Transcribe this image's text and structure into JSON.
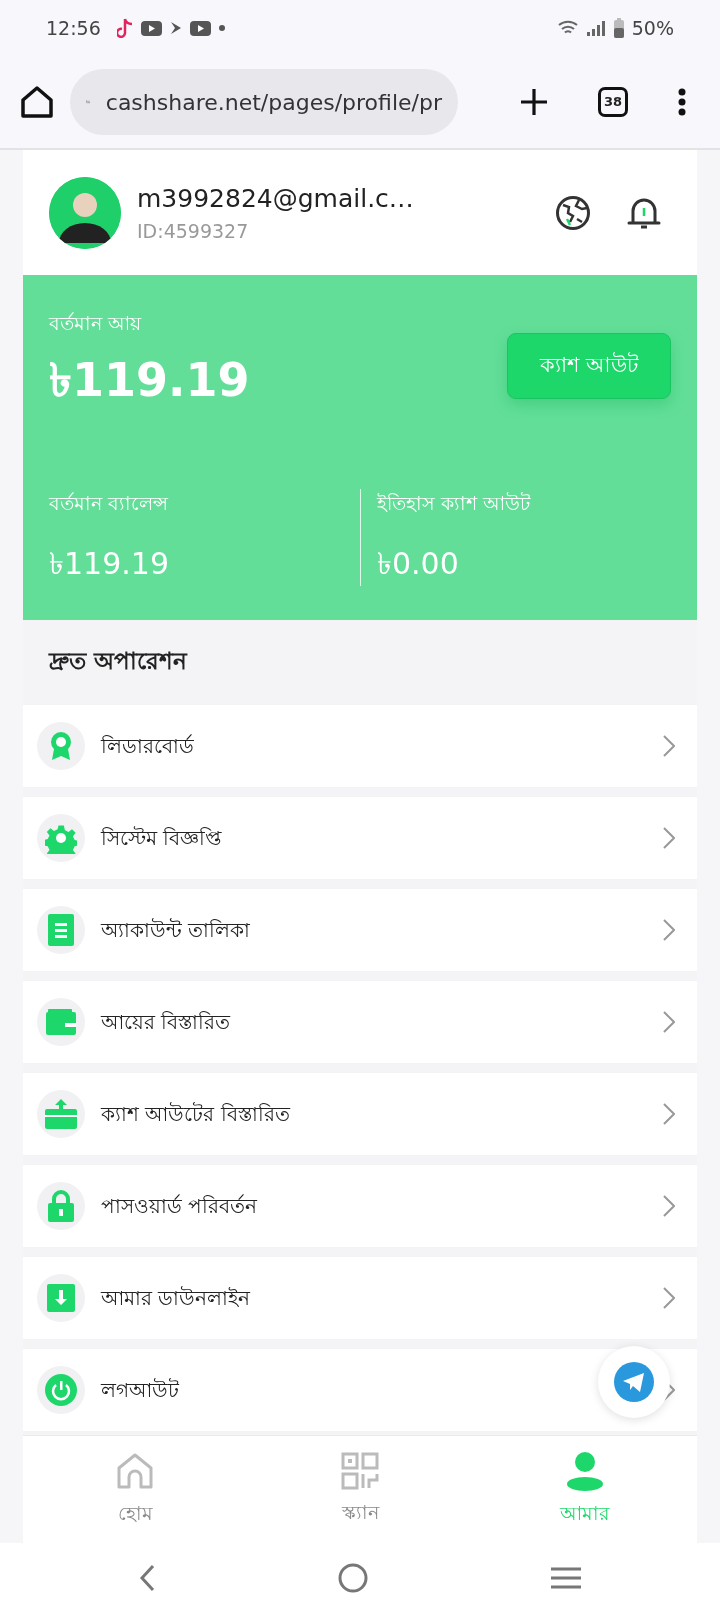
{
  "status_bar": {
    "time": "12:56",
    "battery": "50%"
  },
  "browser": {
    "url": "cashshare.net/pages/profile/pr",
    "tab_count": "38"
  },
  "profile": {
    "email": "m3992824@gmail.c…",
    "id": "ID:4599327"
  },
  "earnings": {
    "label": "বর্তমান আয়",
    "amount": "৳119.19",
    "cashout_button": "ক্যাশ আউট",
    "stats": [
      {
        "label": "বর্তমান ব্যালেন্স",
        "value": "৳119.19"
      },
      {
        "label": "ইতিহাস ক্যাশ আউট",
        "value": "৳0.00"
      }
    ]
  },
  "quick_operations": {
    "title": "দ্রুত অপারেশন",
    "items": [
      {
        "label": "লিডারবোর্ড"
      },
      {
        "label": "সিস্টেম বিজ্ঞপ্তি"
      },
      {
        "label": "অ্যাকাউন্ট তালিকা"
      },
      {
        "label": "আয়ের বিস্তারিত"
      },
      {
        "label": "ক্যাশ আউটের বিস্তারিত"
      },
      {
        "label": "পাসওয়ার্ড পরিবর্তন"
      },
      {
        "label": "আমার ডাউনলাইন"
      },
      {
        "label": "লগআউট"
      }
    ]
  },
  "bottom_nav": [
    {
      "label": "হোম",
      "selected": false
    },
    {
      "label": "স্ক্যান",
      "selected": false
    },
    {
      "label": "আমার",
      "selected": true
    }
  ]
}
